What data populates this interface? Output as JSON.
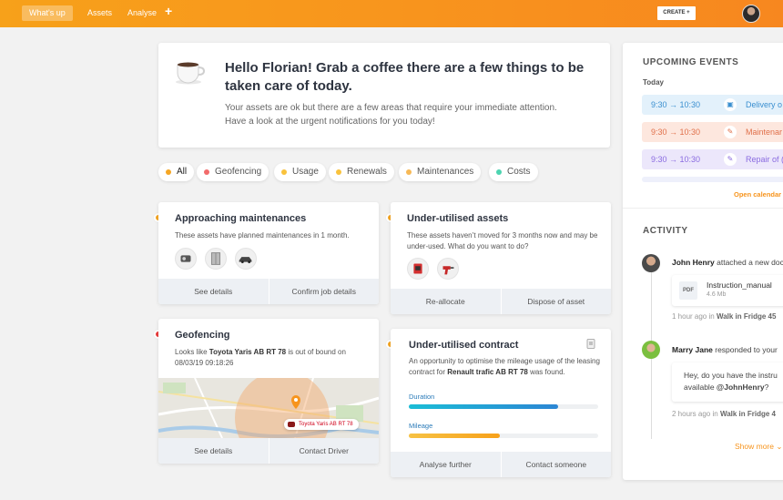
{
  "nav": {
    "active": "What's up",
    "assets": "Assets",
    "analyse": "Analyse",
    "plus": "+",
    "create": "CREATE +"
  },
  "welcome": {
    "title": "Hello Florian! Grab a coffee there are a few things to be taken care of today.",
    "body": "Your assets are ok but there are a few areas that require your immediate attention. Have a look at the urgent notifications for you today!"
  },
  "filters": [
    {
      "label": "All",
      "color": "#f5a623"
    },
    {
      "label": "Geofencing",
      "color": "#f26b6b"
    },
    {
      "label": "Usage",
      "color": "#f9c23c"
    },
    {
      "label": "Renewals",
      "color": "#f9c23c"
    },
    {
      "label": "Maintenances",
      "color": "#f7b956"
    },
    {
      "label": "Costs",
      "color": "#4cd4b0"
    }
  ],
  "maintenance": {
    "title": "Approaching maintenances",
    "text": "These assets have planned maintenances in 1 month.",
    "action1": "See details",
    "action2": "Confirm job details"
  },
  "underutilised": {
    "title": "Under-utilised assets",
    "text": "These assets haven’t moved for 3 months now and may be under-used. What do you want to do?",
    "action1": "Re-allocate",
    "action2": "Dispose of asset"
  },
  "geofencing": {
    "title": "Geofencing",
    "text_pre": "Looks like ",
    "vehicle": "Toyota Yaris AB RT 78",
    "text_post": " is out of bound on",
    "date": "08/03/19 09:18:26",
    "map_label": "Toyota Yaris AB RT 78",
    "action1": "See details",
    "action2": "Contact Driver"
  },
  "contract": {
    "title": "Under-utilised contract",
    "text_pre": "An opportunity to optimise the mileage usage of the leasing contract for ",
    "vehicle": "Renault trafic AB RT 78",
    "text_post": " was found.",
    "duration_label": "Duration",
    "duration_value": 0.79,
    "mileage_label": "Mileage",
    "mileage_value": 0.48,
    "action1": "Analyse further",
    "action2": "Contact someone"
  },
  "events": {
    "title": "UPCOMING EVENTS",
    "today": "Today",
    "items": [
      {
        "time": "9:30 → 10:30",
        "name": "Delivery o",
        "bg": "#e3f1fb",
        "color": "#3a8fd0"
      },
      {
        "time": "9:30 → 10:30",
        "name": "Maintenar",
        "bg": "#fde7de",
        "color": "#e0704a"
      },
      {
        "time": "9:30 → 10:30",
        "name": "Repair of (",
        "bg": "#ece7fb",
        "color": "#8a6be0"
      }
    ],
    "open_calendar": "Open calendar"
  },
  "activity": {
    "title": "ACTIVITY",
    "item1": {
      "user": "John Henry",
      "action": " attached a new doc",
      "file_type": "PDF",
      "file_name": "Instruction_manual",
      "file_size": "4.6 Mb",
      "time_pre": "1 hour ago in ",
      "location": "Walk in Fridge 45"
    },
    "item2": {
      "user": "Marry Jane",
      "action": " responded to your",
      "message_pre": "Hey, do you have the instru available ",
      "mention": "@JohnHenry",
      "message_post": "?",
      "time_pre": "2 hours ago in ",
      "location": "Walk in Fridge 4"
    },
    "show_more": "Show more"
  }
}
